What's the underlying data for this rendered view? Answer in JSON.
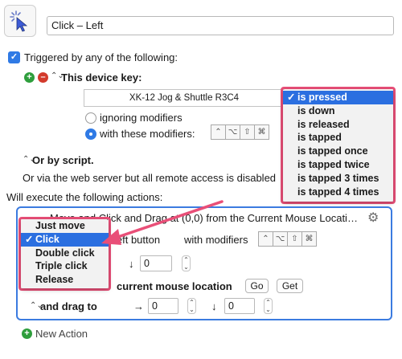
{
  "macro": {
    "icon": "pointer-click-icon",
    "title": "Click – Left"
  },
  "trigger": {
    "label": "Triggered by any of the following:",
    "device_key_heading": "This device key:",
    "device_name": "XK-12 Jog & Shuttle R3C4",
    "ignoring_label": "ignoring modifiers",
    "with_label": "with these modifiers:",
    "with_selected": true,
    "modifier_keys": [
      "⌃",
      "⌥",
      "⇧",
      "⌘"
    ],
    "or_by_script": "Or by script.",
    "webserver_text": "Or via the web server but all remote access is disabled",
    "state_menu": {
      "items": [
        "is pressed",
        "is down",
        "is released",
        "is tapped",
        "is tapped once",
        "is tapped twice",
        "is tapped 3 times",
        "is tapped 4 times"
      ],
      "selected": "is pressed"
    }
  },
  "actions": {
    "heading": "Will execute the following actions:",
    "action_title": "Move and Click and Drag at (0,0) from the Current Mouse Locati…",
    "button_label": "left button",
    "with_modifiers_label": "with modifiers",
    "coords_y_value": "0",
    "relative_label": "current mouse location",
    "go_label": "Go",
    "get_label": "Get",
    "drag_label": "and drag to",
    "drag_x_value": "0",
    "drag_y_value": "0",
    "click_menu": {
      "items": [
        "Just move",
        "Click",
        "Double click",
        "Triple click",
        "Release"
      ],
      "selected": "Click"
    },
    "new_action_label": "New Action"
  },
  "colors": {
    "highlight": "#e94f78",
    "selection": "#2b6fe0",
    "action_border": "#3b7be0"
  }
}
